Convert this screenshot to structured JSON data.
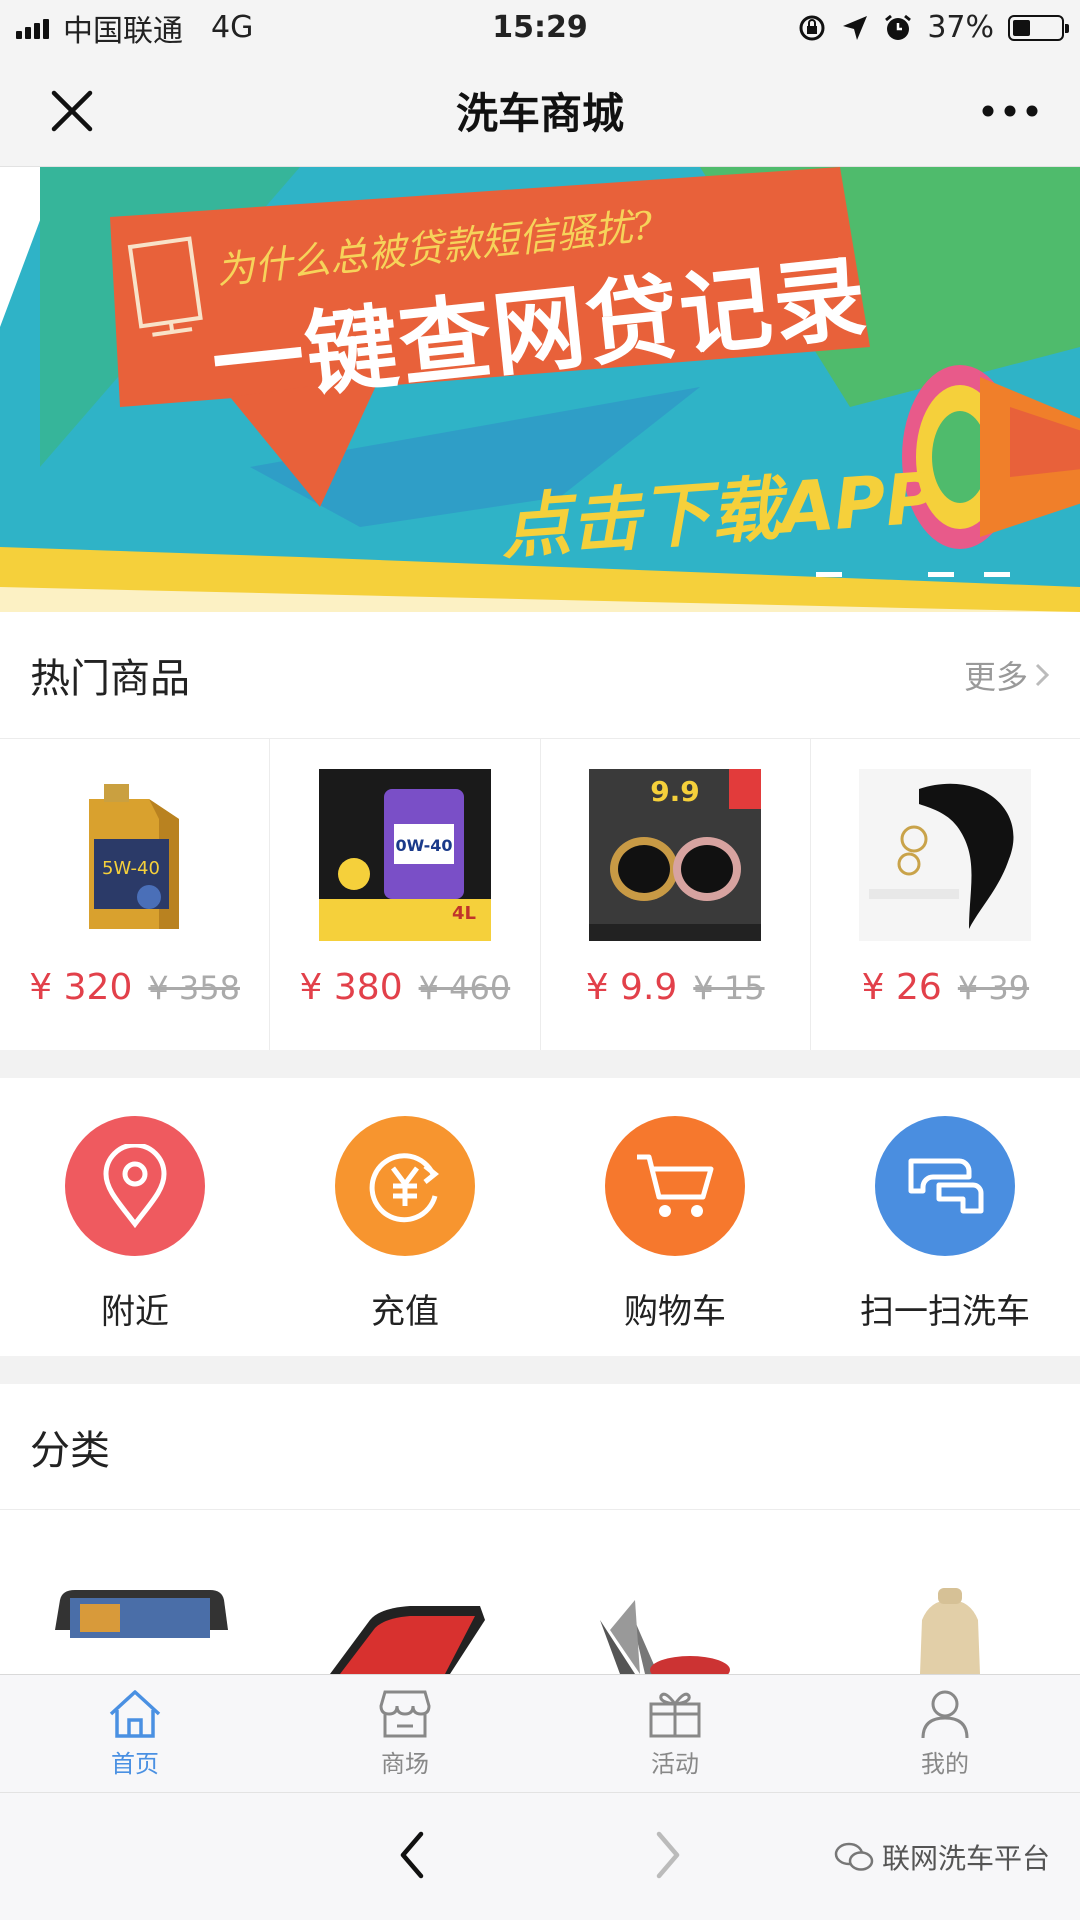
{
  "status_bar": {
    "carrier": "中国联通",
    "network": "4G",
    "time": "15:29",
    "battery_percent": "37%",
    "battery_level": 0.37
  },
  "nav": {
    "title": "洗车商城",
    "close_icon": "close-icon",
    "more_icon": "more-dots-icon"
  },
  "banner": {
    "subtitle": "为什么总被贷款短信骚扰?",
    "headline": "一键查网贷记录",
    "cta": "点击下载APP",
    "colors": {
      "teal": "#34b0c0",
      "orange": "#e8613a",
      "green": "#4fbb6c",
      "yellow": "#f5d03b"
    }
  },
  "hot": {
    "title": "热门商品",
    "more": "更多",
    "products": [
      {
        "price": "¥ 320",
        "old_price": "¥ 358",
        "icon": "engine-oil-can"
      },
      {
        "price": "¥ 380",
        "old_price": "¥ 460",
        "icon": "liqui-moly-oil"
      },
      {
        "price": "¥ 9.9",
        "old_price": "¥ 15",
        "icon": "magnetic-phone-holder"
      },
      {
        "price": "¥ 26",
        "old_price": "¥ 39",
        "icon": "fur-tail-keychain"
      }
    ]
  },
  "actions": [
    {
      "label": "附近",
      "icon": "location-pin-icon",
      "color": "#ef5a5f"
    },
    {
      "label": "充值",
      "icon": "yen-recharge-icon",
      "color": "#f7952f"
    },
    {
      "label": "购物车",
      "icon": "shopping-cart-icon",
      "color": "#f6782d"
    },
    {
      "label": "扫一扫洗车",
      "icon": "scan-wash-icon",
      "color": "#4a8ee0"
    }
  ],
  "category": {
    "title": "分类"
  },
  "tabs": [
    {
      "label": "首页",
      "icon": "home-icon",
      "active": true
    },
    {
      "label": "商场",
      "icon": "store-icon",
      "active": false
    },
    {
      "label": "活动",
      "icon": "gift-icon",
      "active": false
    },
    {
      "label": "我的",
      "icon": "user-icon",
      "active": false
    }
  ],
  "browser": {
    "watermark": "联网洗车平台"
  }
}
